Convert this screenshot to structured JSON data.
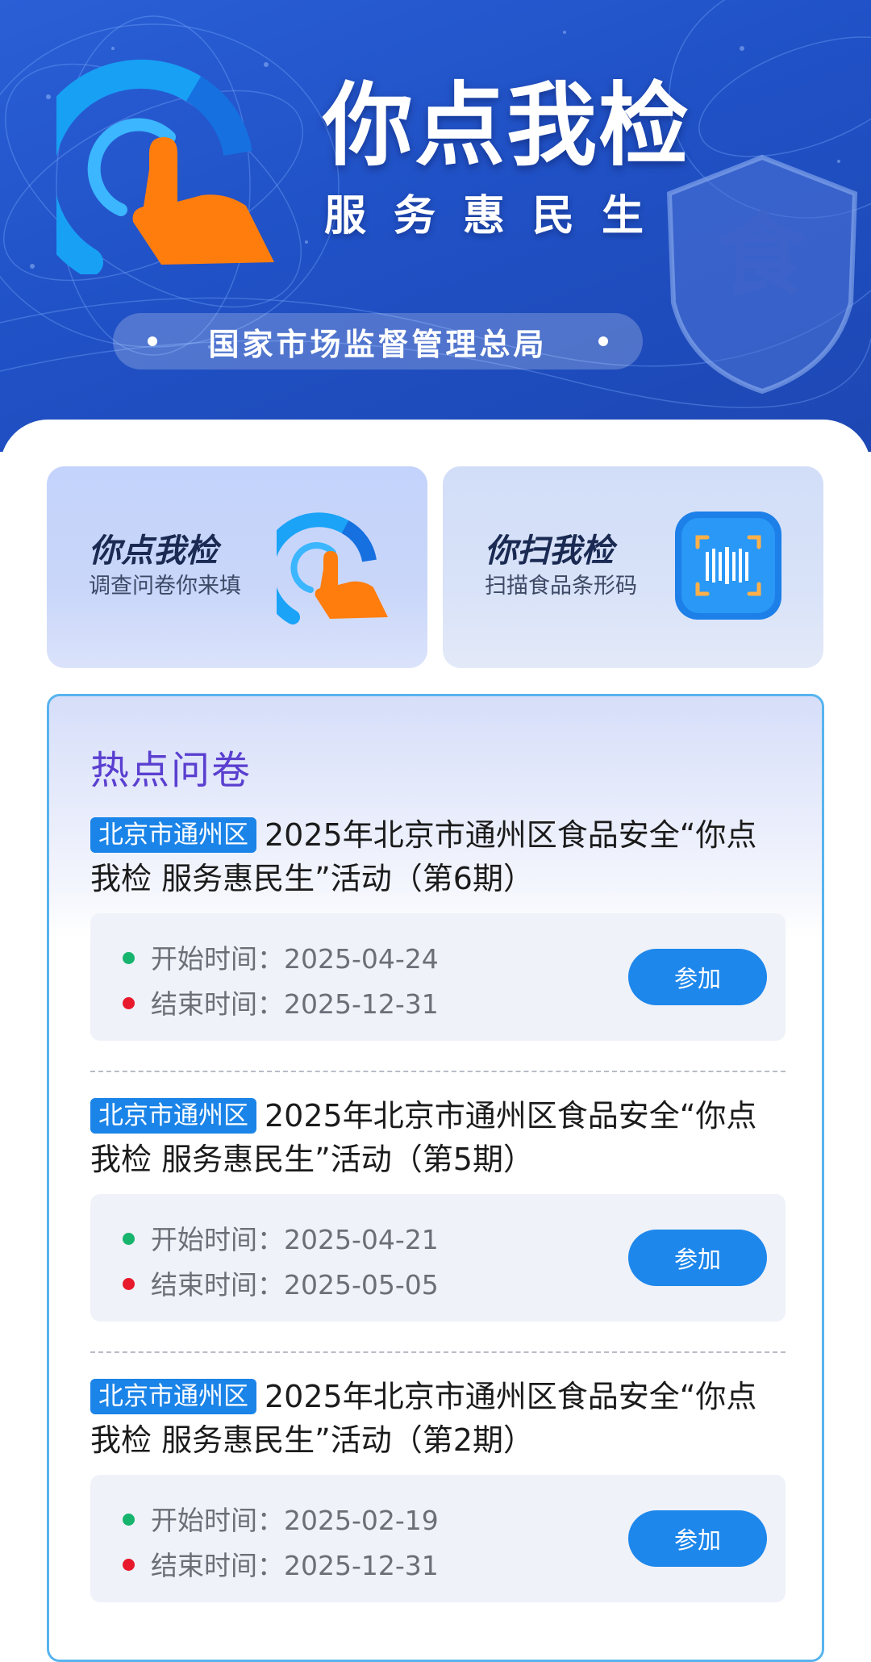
{
  "hero": {
    "title": "你点我检",
    "subtitle": "服务惠民生",
    "agency": "国家市场监督管理总局",
    "shield_char": "食"
  },
  "entry_cards": [
    {
      "title": "你点我检",
      "subtitle": "调查问卷你来填",
      "icon": "tap-hand-icon"
    },
    {
      "title": "你扫我检",
      "subtitle": "扫描食品条形码",
      "icon": "barcode-scan-icon"
    }
  ],
  "hot_surveys": {
    "title": "热点问卷",
    "start_label": "开始时间：",
    "end_label": "结束时间：",
    "items": [
      {
        "region": "北京市通州区",
        "title": "2025年北京市通州区食品安全“你点我检 服务惠民生”活动（第6期）",
        "start": "2025-04-24",
        "end": "2025-12-31",
        "button": "参加"
      },
      {
        "region": "北京市通州区",
        "title": "2025年北京市通州区食品安全“你点我检 服务惠民生”活动（第5期）",
        "start": "2025-04-21",
        "end": "2025-05-05",
        "button": "参加"
      },
      {
        "region": "北京市通州区",
        "title": "2025年北京市通州区食品安全“你点我检 服务惠民生”活动（第2期）",
        "start": "2025-02-19",
        "end": "2025-12-31",
        "button": "参加"
      }
    ]
  },
  "colors": {
    "hero_blue": "#2051c6",
    "accent_blue": "#1e87eb",
    "panel_title": "#5a3fd0",
    "start_dot": "#17b46e",
    "end_dot": "#e8192c"
  }
}
